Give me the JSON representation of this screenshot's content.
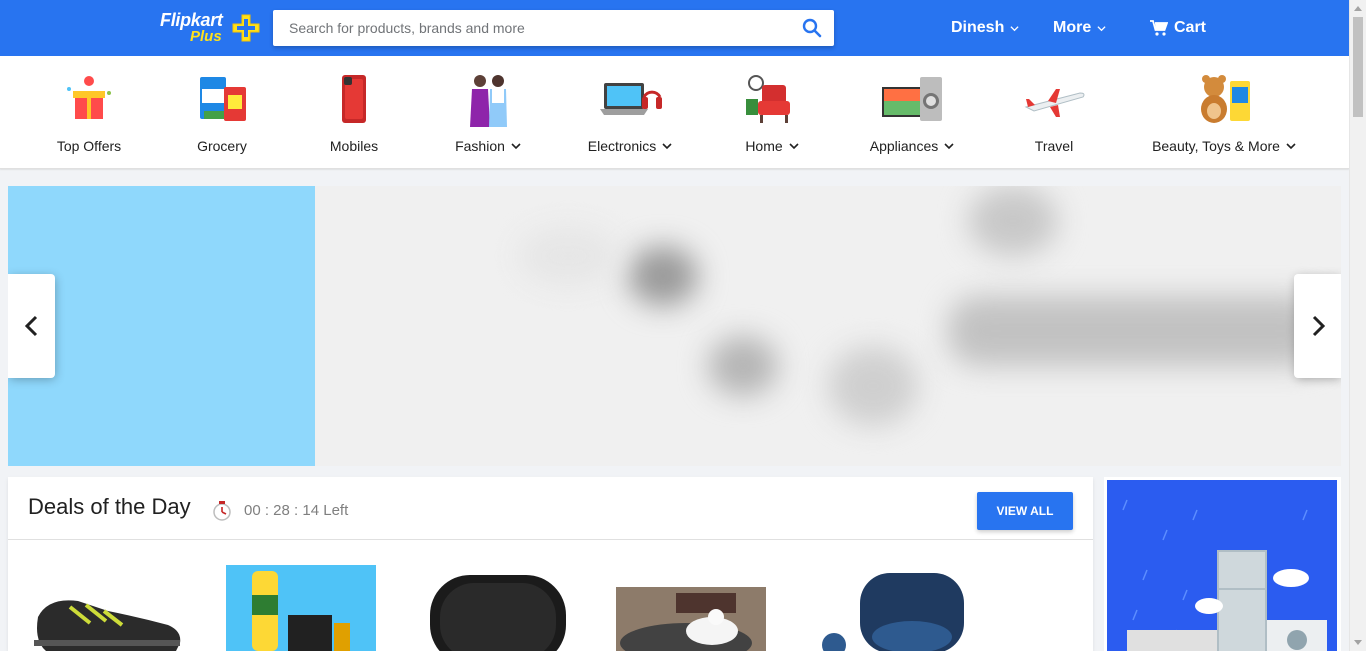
{
  "header": {
    "logo_text": "Flipkart",
    "logo_subtext": "Plus",
    "search_placeholder": "Search for products, brands and more",
    "user_label": "Dinesh",
    "more_label": "More",
    "cart_label": "Cart",
    "brand_color": "#2874f0",
    "accent_color": "#ffe11b"
  },
  "categories": [
    {
      "label": "Top Offers",
      "icon": "gift-icon",
      "dropdown": false
    },
    {
      "label": "Grocery",
      "icon": "grocery-icon",
      "dropdown": false
    },
    {
      "label": "Mobiles",
      "icon": "mobile-phone-icon",
      "dropdown": false
    },
    {
      "label": "Fashion",
      "icon": "fashion-icon",
      "dropdown": true
    },
    {
      "label": "Electronics",
      "icon": "laptop-icon",
      "dropdown": true
    },
    {
      "label": "Home",
      "icon": "armchair-icon",
      "dropdown": true
    },
    {
      "label": "Appliances",
      "icon": "appliances-icon",
      "dropdown": true
    },
    {
      "label": "Travel",
      "icon": "airplane-icon",
      "dropdown": false
    },
    {
      "label": "Beauty, Toys & More",
      "icon": "teddy-bear-icon",
      "dropdown": true
    }
  ],
  "banner": {
    "prev_icon": "chevron-left-icon",
    "next_icon": "chevron-right-icon"
  },
  "deals": {
    "title": "Deals of the Day",
    "timer": "00 : 28 : 14 Left",
    "view_all_label": "VIEW ALL",
    "products": [
      {
        "name": "shoe",
        "icon": "sneaker-icon"
      },
      {
        "name": "deodorant",
        "icon": "deodorant-icon"
      },
      {
        "name": "speaker",
        "icon": "speaker-icon"
      },
      {
        "name": "pet-bed",
        "icon": "pet-bed-icon"
      },
      {
        "name": "earbuds",
        "icon": "earbuds-icon"
      }
    ]
  }
}
